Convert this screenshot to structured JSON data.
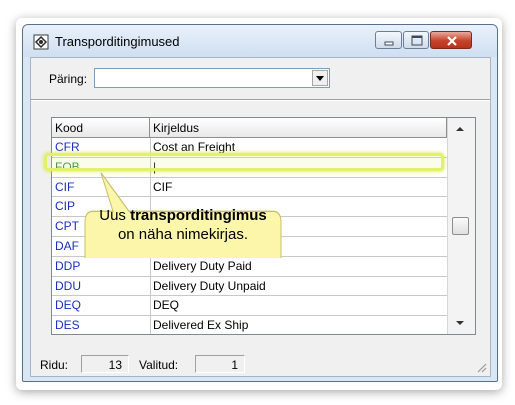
{
  "window": {
    "title": "Transporditingimused"
  },
  "query": {
    "label": "Päring:",
    "value": ""
  },
  "grid": {
    "columns": [
      "Kood",
      "Kirjeldus"
    ],
    "rows": [
      {
        "code": "CFR",
        "desc": "Cost an Freight"
      },
      {
        "code": "FOB",
        "desc": "|"
      },
      {
        "code": "CIF",
        "desc": "CIF"
      },
      {
        "code": "CIP",
        "desc": ""
      },
      {
        "code": "CPT",
        "desc": ""
      },
      {
        "code": "DAF",
        "desc": ""
      },
      {
        "code": "DDP",
        "desc": "Delivery Duty Paid"
      },
      {
        "code": "DDU",
        "desc": "Delivery Duty Unpaid"
      },
      {
        "code": "DEQ",
        "desc": "DEQ"
      },
      {
        "code": "DES",
        "desc": "Delivered Ex Ship"
      }
    ],
    "selected_row": 1
  },
  "callout": {
    "line1_pre": "Uus ",
    "line1_bold": "transporditingimus",
    "line2": "on näha nimekirjas."
  },
  "status": {
    "rows_label": "Ridu:",
    "rows_value": "13",
    "selected_label": "Valitud:",
    "selected_value": "1"
  },
  "colors": {
    "code_text": "#1a2ec2",
    "highlight": "#e2f06a",
    "callout_fill": "#fbf6a9"
  },
  "icons": [
    "app-icon",
    "minimize-icon",
    "maximize-icon",
    "close-icon",
    "dropdown-arrow-icon",
    "scroll-up-icon",
    "scroll-down-icon",
    "resize-grip-icon"
  ]
}
